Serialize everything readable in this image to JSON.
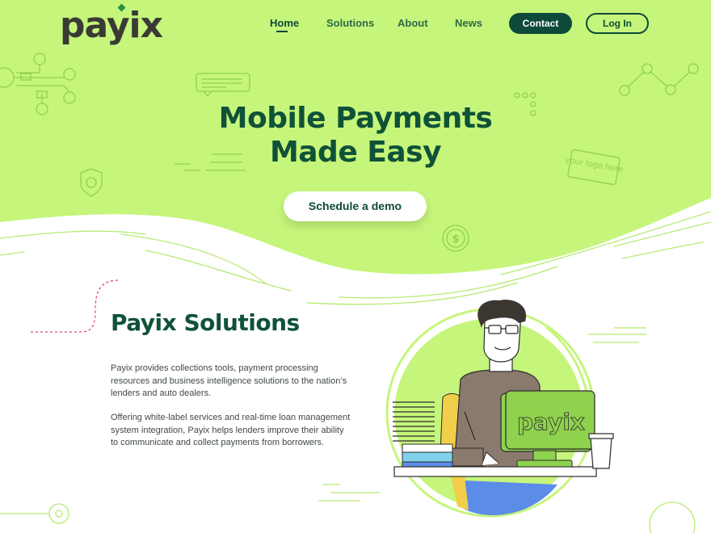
{
  "brand": {
    "logo_text": "payix",
    "monitor_logo": "payix"
  },
  "nav": {
    "items": [
      {
        "label": "Home",
        "active": true
      },
      {
        "label": "Solutions",
        "active": false
      },
      {
        "label": "About",
        "active": false
      },
      {
        "label": "News",
        "active": false
      }
    ],
    "contact_label": "Contact",
    "login_label": "Log In"
  },
  "hero": {
    "title_line1": "Mobile Payments",
    "title_line2": "Made Easy",
    "cta_label": "Schedule a demo",
    "decor_logo_text": "your logo here"
  },
  "solutions": {
    "title": "Payix Solutions",
    "paragraph1": "Payix provides collections tools, payment processing resources and business intelligence solutions to the nation’s lenders and auto dealers.",
    "paragraph2": "Offering white-label services and real-time loan management system integration, Payix helps lenders improve their ability to communicate and collect payments from borrowers."
  },
  "colors": {
    "hero_bg": "#c6f57b",
    "brand_dark": "#0e4a3a",
    "heading_green": "#0f5238",
    "line_green": "#9fdc5a",
    "accent_pink": "#e0457b"
  }
}
